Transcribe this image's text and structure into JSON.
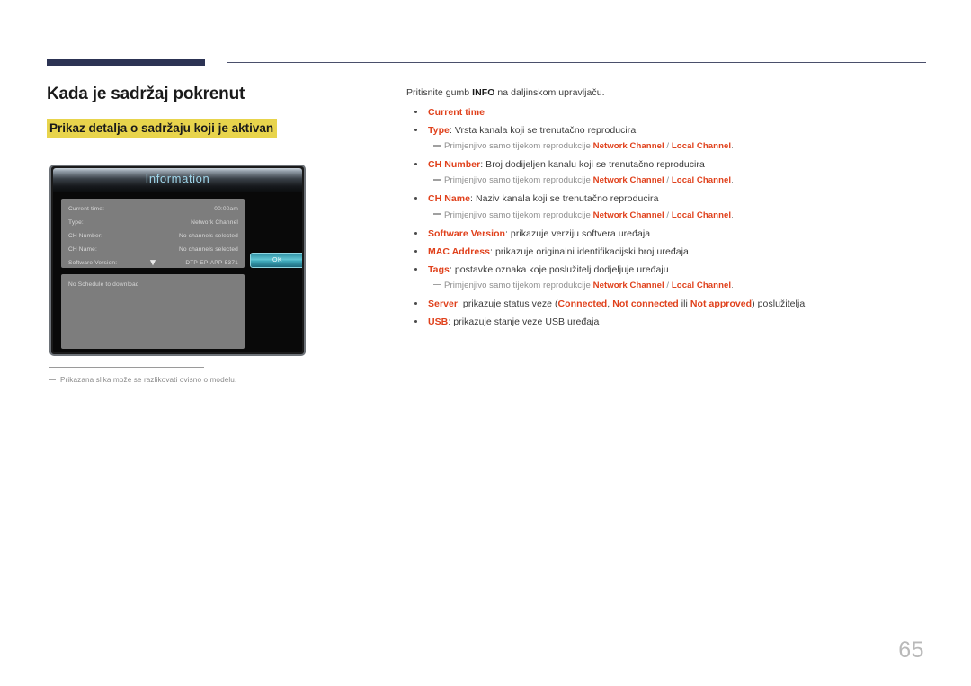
{
  "header": {
    "accent_color": "#2c3354",
    "rule_color": "#4a4f6b"
  },
  "left": {
    "page_title": "Kada je sadržaj pokrenut",
    "sub_title": "Prikaz detalja o sadržaju koji je aktivan",
    "sub_title_highlight": "#e8d44c",
    "note": "Prikazana slika može se razlikovati ovisno o modelu."
  },
  "tv": {
    "window_title": "Information",
    "rows": [
      {
        "label": "Current time:",
        "value": "00:00am"
      },
      {
        "label": "Type:",
        "value": "Network Channel"
      },
      {
        "label": "CH Number:",
        "value": "No channels selected"
      },
      {
        "label": "CH Name:",
        "value": "No channels selected"
      },
      {
        "label": "Software Version:",
        "value": "DTP-EP-APP-5371"
      }
    ],
    "scroll_icon": "chevron-down-icon",
    "schedule_text": "No Schedule to download",
    "ok_label": "OK"
  },
  "right": {
    "intro_pre": "Pritisnite gumb ",
    "intro_bold": "INFO",
    "intro_post": " na daljinskom upravljaču.",
    "items": [
      {
        "term": "Current time",
        "desc": "",
        "subnote": null
      },
      {
        "term": "Type",
        "desc": ": Vrsta kanala koji se trenutačno reproducira",
        "subnote": {
          "pre": "Primjenjivo samo tijekom reprodukcije ",
          "hl1": "Network Channel",
          "mid": " / ",
          "hl2": "Local Channel",
          "post": "."
        }
      },
      {
        "term": "CH Number",
        "desc": ": Broj dodijeljen kanalu koji se trenutačno reproducira",
        "subnote": {
          "pre": "Primjenjivo samo tijekom reprodukcije ",
          "hl1": "Network Channel",
          "mid": " / ",
          "hl2": "Local Channel",
          "post": "."
        }
      },
      {
        "term": "CH Name",
        "desc": ": Naziv kanala koji se trenutačno reproducira",
        "subnote": {
          "pre": "Primjenjivo samo tijekom reprodukcije ",
          "hl1": "Network Channel",
          "mid": " / ",
          "hl2": "Local Channel",
          "post": "."
        }
      },
      {
        "term": "Software Version",
        "desc": ": prikazuje verziju softvera uređaja",
        "subnote": null
      },
      {
        "term": "MAC Address",
        "desc": ": prikazuje originalni identifikacijski broj uređaja",
        "subnote": null
      },
      {
        "term": "Tags",
        "desc": ": postavke oznaka koje poslužitelj dodjeljuje uređaju",
        "subnote": {
          "pre": "Primjenjivo samo tijekom reprodukcije ",
          "hl1": "Network Channel",
          "mid": " / ",
          "hl2": "Local Channel",
          "post": "."
        }
      },
      {
        "term": "Server",
        "desc": ": prikazuje status veze (",
        "server_states": [
          "Connected",
          "Not connected",
          "Not approved"
        ],
        "server_sep1": ", ",
        "server_sep2": " ili ",
        "server_tail": ") poslužitelja",
        "subnote": null
      },
      {
        "term": "USB",
        "desc": ": prikazuje stanje veze USB uređaja",
        "subnote": null
      }
    ],
    "accent_color": "#e0411c"
  },
  "page_number": "65"
}
